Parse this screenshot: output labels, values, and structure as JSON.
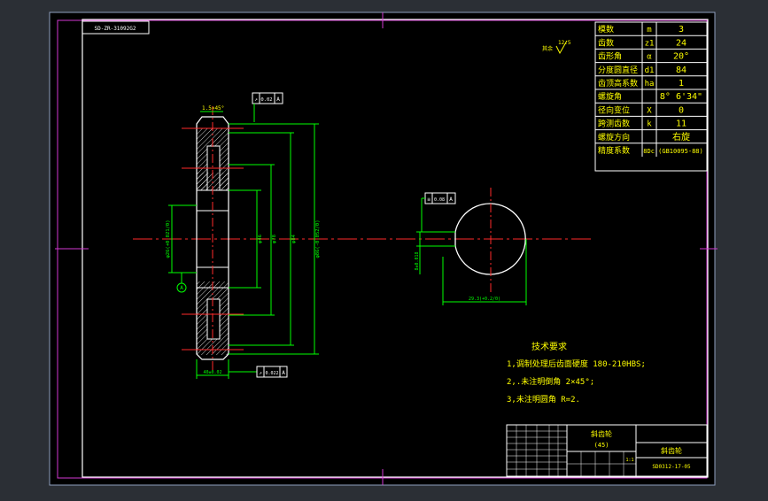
{
  "drawing_code": "SD-ZR-31092G2",
  "roughness_note": "其余",
  "roughness_value": "12.5",
  "chamfer_label": "1.5×45°",
  "tol_top_value": "0.02",
  "tol_top_datum": "A",
  "tol_bottom_value": "0.022",
  "tol_bottom_datum": "A",
  "tol_side_value": "0.08",
  "tol_side_datum": "A",
  "datum_letter": "A",
  "dim_bore": "φ26(+0.021/0)",
  "dim_hub": "φ46",
  "dim_root": "φ78",
  "dim_pitch": "φ84",
  "dim_tip": "φ86(-0.052/0)",
  "dim_width": "40±0.02",
  "dim_key_width": "8±0.018",
  "dim_keyway": "29.3(+0.2/0)",
  "params": [
    {
      "name": "模数",
      "symbol": "m",
      "value": "3"
    },
    {
      "name": "齿数",
      "symbol": "z1",
      "value": "24"
    },
    {
      "name": "齿形角",
      "symbol": "α",
      "value": "20°"
    },
    {
      "name": "分度圆直径",
      "symbol": "d1",
      "value": "84"
    },
    {
      "name": "齿顶高系数",
      "symbol": "ha",
      "value": "1"
    },
    {
      "name": "螺旋角",
      "symbol": "",
      "value": "8° 6'34\""
    },
    {
      "name": "径向变位",
      "symbol": "X",
      "value": "0"
    },
    {
      "name": "跨测齿数",
      "symbol": "k",
      "value": "11"
    },
    {
      "name": "螺旋方向",
      "symbol": "",
      "value": "右旋"
    },
    {
      "name": "精度系数",
      "symbol": "",
      "value": "8Dc (GB10095-88)"
    }
  ],
  "tech_title": "技术要求",
  "tech_items": [
    "1,调制处理后齿面硬度 180-210HBS;",
    "2,.未注明倒角 2×45°;",
    "3,未注明圆角 R=2."
  ],
  "title_block": {
    "part_name": "斜齿轮",
    "material": "(45)",
    "drawing_title": "斜齿轮",
    "scale": "1:1",
    "drawing_number": "SD0312-17-05"
  }
}
